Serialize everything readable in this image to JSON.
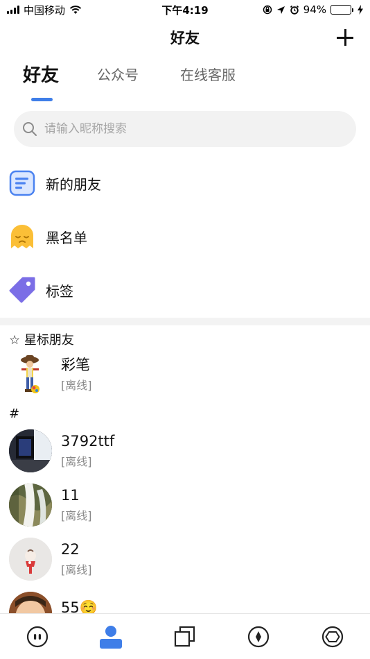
{
  "status_bar": {
    "carrier": "中国移动",
    "time": "下午4:19",
    "battery": "94%",
    "battery_level": 0.94,
    "battery_color": "#4cd964"
  },
  "header": {
    "title": "好友",
    "add_icon": "plus-icon"
  },
  "tabs": [
    {
      "label": "好友",
      "active": true
    },
    {
      "label": "公众号",
      "active": false
    },
    {
      "label": "在线客服",
      "active": false
    }
  ],
  "accent_color": "#3f7ee8",
  "search": {
    "placeholder": "请输入昵称搜索",
    "value": "",
    "icon": "search-icon"
  },
  "menu": [
    {
      "label": "新的朋友",
      "icon": "new-friends-icon"
    },
    {
      "label": "黑名单",
      "icon": "blacklist-ghost-icon"
    },
    {
      "label": "标签",
      "icon": "tag-icon"
    }
  ],
  "starred_section": {
    "title": "☆ 星标朋友",
    "friends": [
      {
        "name": "彩笔",
        "status": "[离线]"
      }
    ]
  },
  "hash_section": {
    "title": "#",
    "friends": [
      {
        "name": "3792ttf",
        "status": "[离线]"
      },
      {
        "name": "11",
        "status": "[离线]"
      },
      {
        "name": "22",
        "status": "[离线]"
      },
      {
        "name": "55☺️",
        "status": ""
      }
    ]
  },
  "bottom_tabs": [
    {
      "icon": "chat-icon",
      "active": false
    },
    {
      "icon": "contacts-icon",
      "active": true
    },
    {
      "icon": "layers-icon",
      "active": false
    },
    {
      "icon": "compass-icon",
      "active": false
    },
    {
      "icon": "settings-icon",
      "active": false
    }
  ]
}
